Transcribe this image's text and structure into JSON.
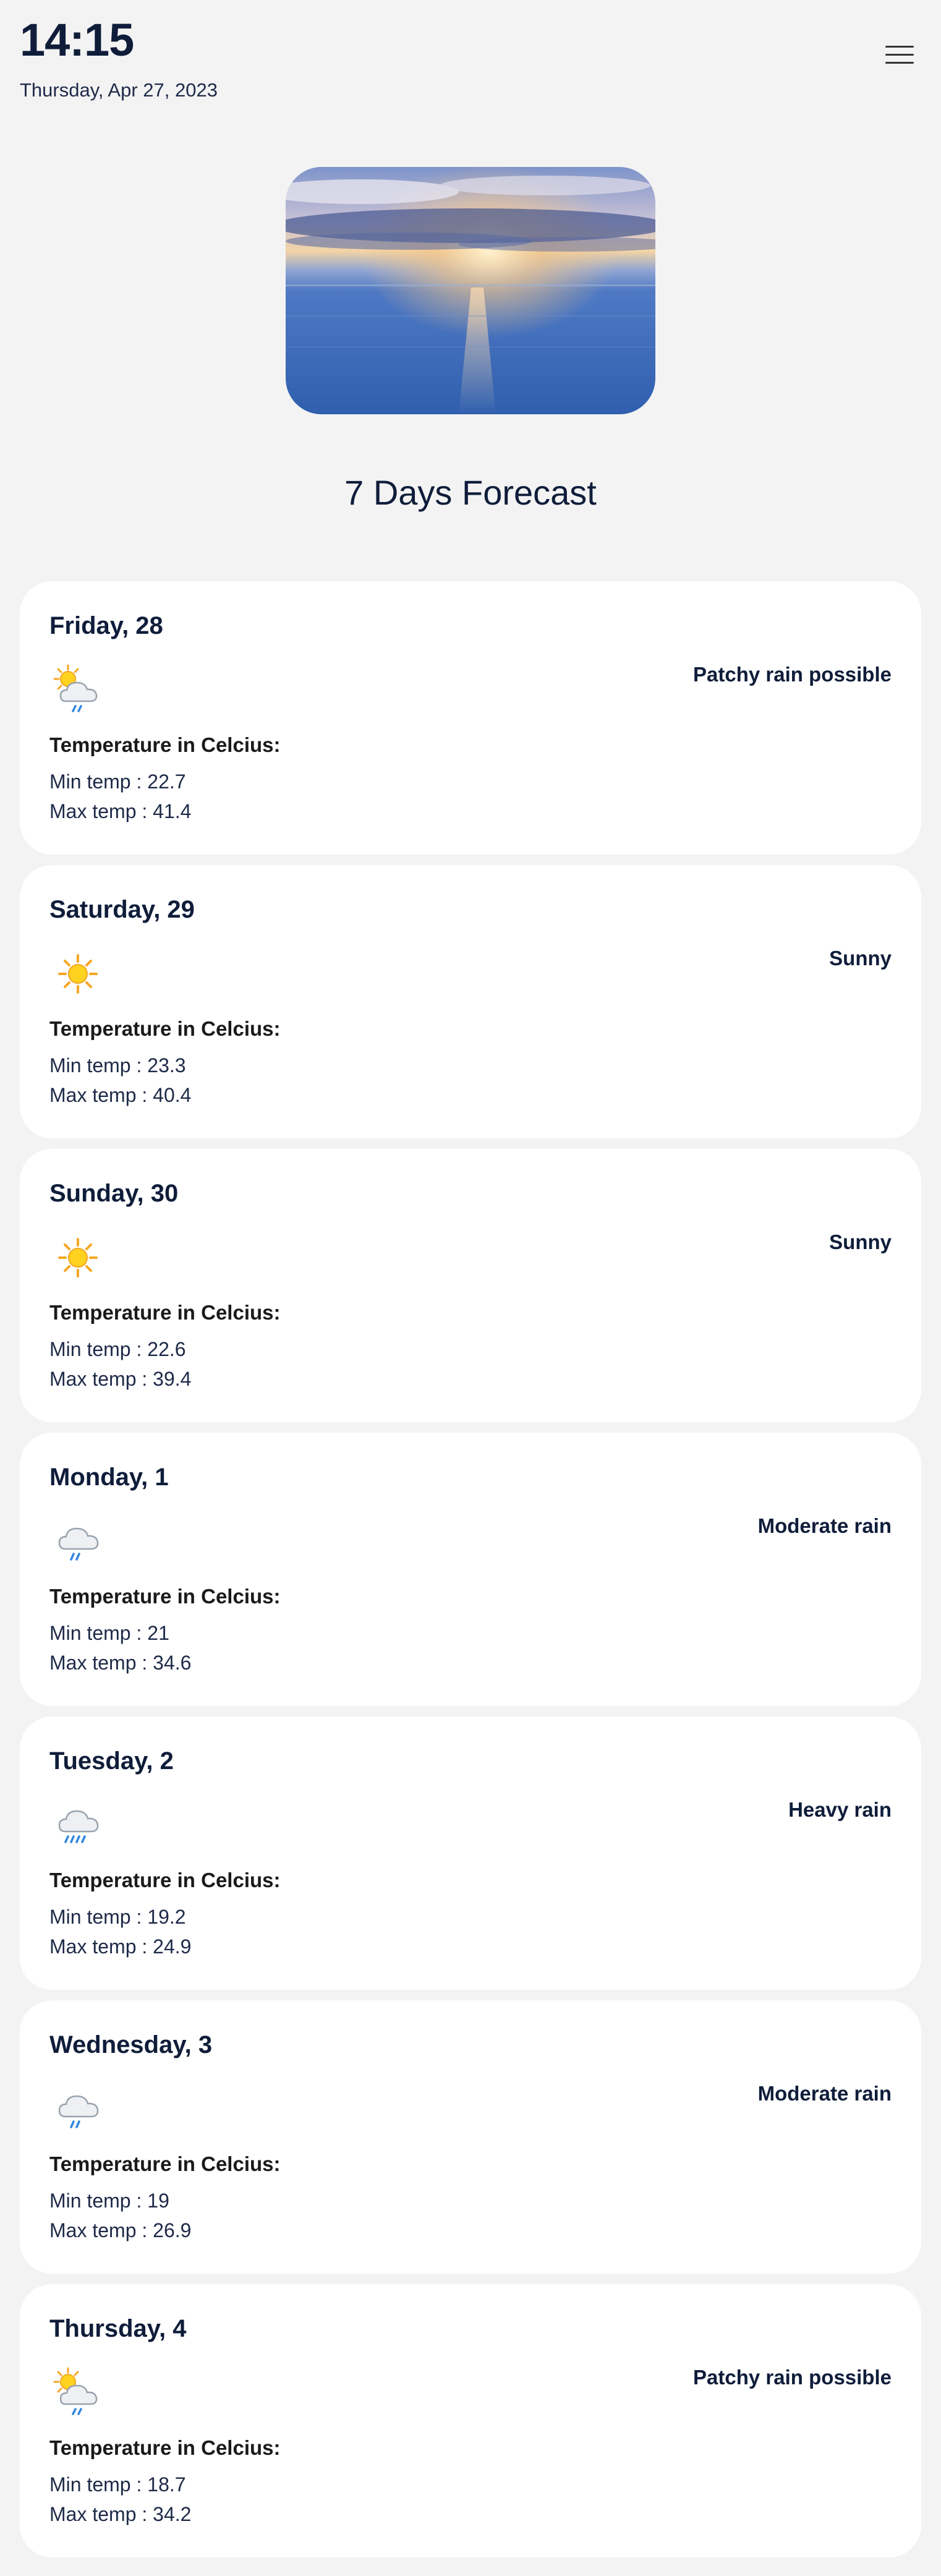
{
  "header": {
    "time": "14:15",
    "date": "Thursday, Apr 27, 2023"
  },
  "menu": {
    "icon": "hamburger-menu-icon"
  },
  "forecast": {
    "title": "7 Days Forecast",
    "temp_label": "Temperature in Celcius:",
    "days": [
      {
        "day": "Friday, 28",
        "condition": "Patchy rain possible",
        "icon": "patchy-rain-icon",
        "min": "Min temp : 22.7",
        "max": "Max temp : 41.4"
      },
      {
        "day": "Saturday, 29",
        "condition": "Sunny",
        "icon": "sun-icon",
        "min": "Min temp : 23.3",
        "max": "Max temp : 40.4"
      },
      {
        "day": "Sunday, 30",
        "condition": "Sunny",
        "icon": "sun-icon",
        "min": "Min temp : 22.6",
        "max": "Max temp : 39.4"
      },
      {
        "day": "Monday, 1",
        "condition": "Moderate rain",
        "icon": "moderate-rain-icon",
        "min": "Min temp : 21",
        "max": "Max temp : 34.6"
      },
      {
        "day": "Tuesday, 2",
        "condition": "Heavy rain",
        "icon": "heavy-rain-icon",
        "min": "Min temp : 19.2",
        "max": "Max temp : 24.9"
      },
      {
        "day": "Wednesday, 3",
        "condition": "Moderate rain",
        "icon": "moderate-rain-icon",
        "min": "Min temp : 19",
        "max": "Max temp : 26.9"
      },
      {
        "day": "Thursday, 4",
        "condition": "Patchy rain possible",
        "icon": "patchy-rain-icon",
        "min": "Min temp : 18.7",
        "max": "Max temp : 34.2"
      }
    ]
  }
}
